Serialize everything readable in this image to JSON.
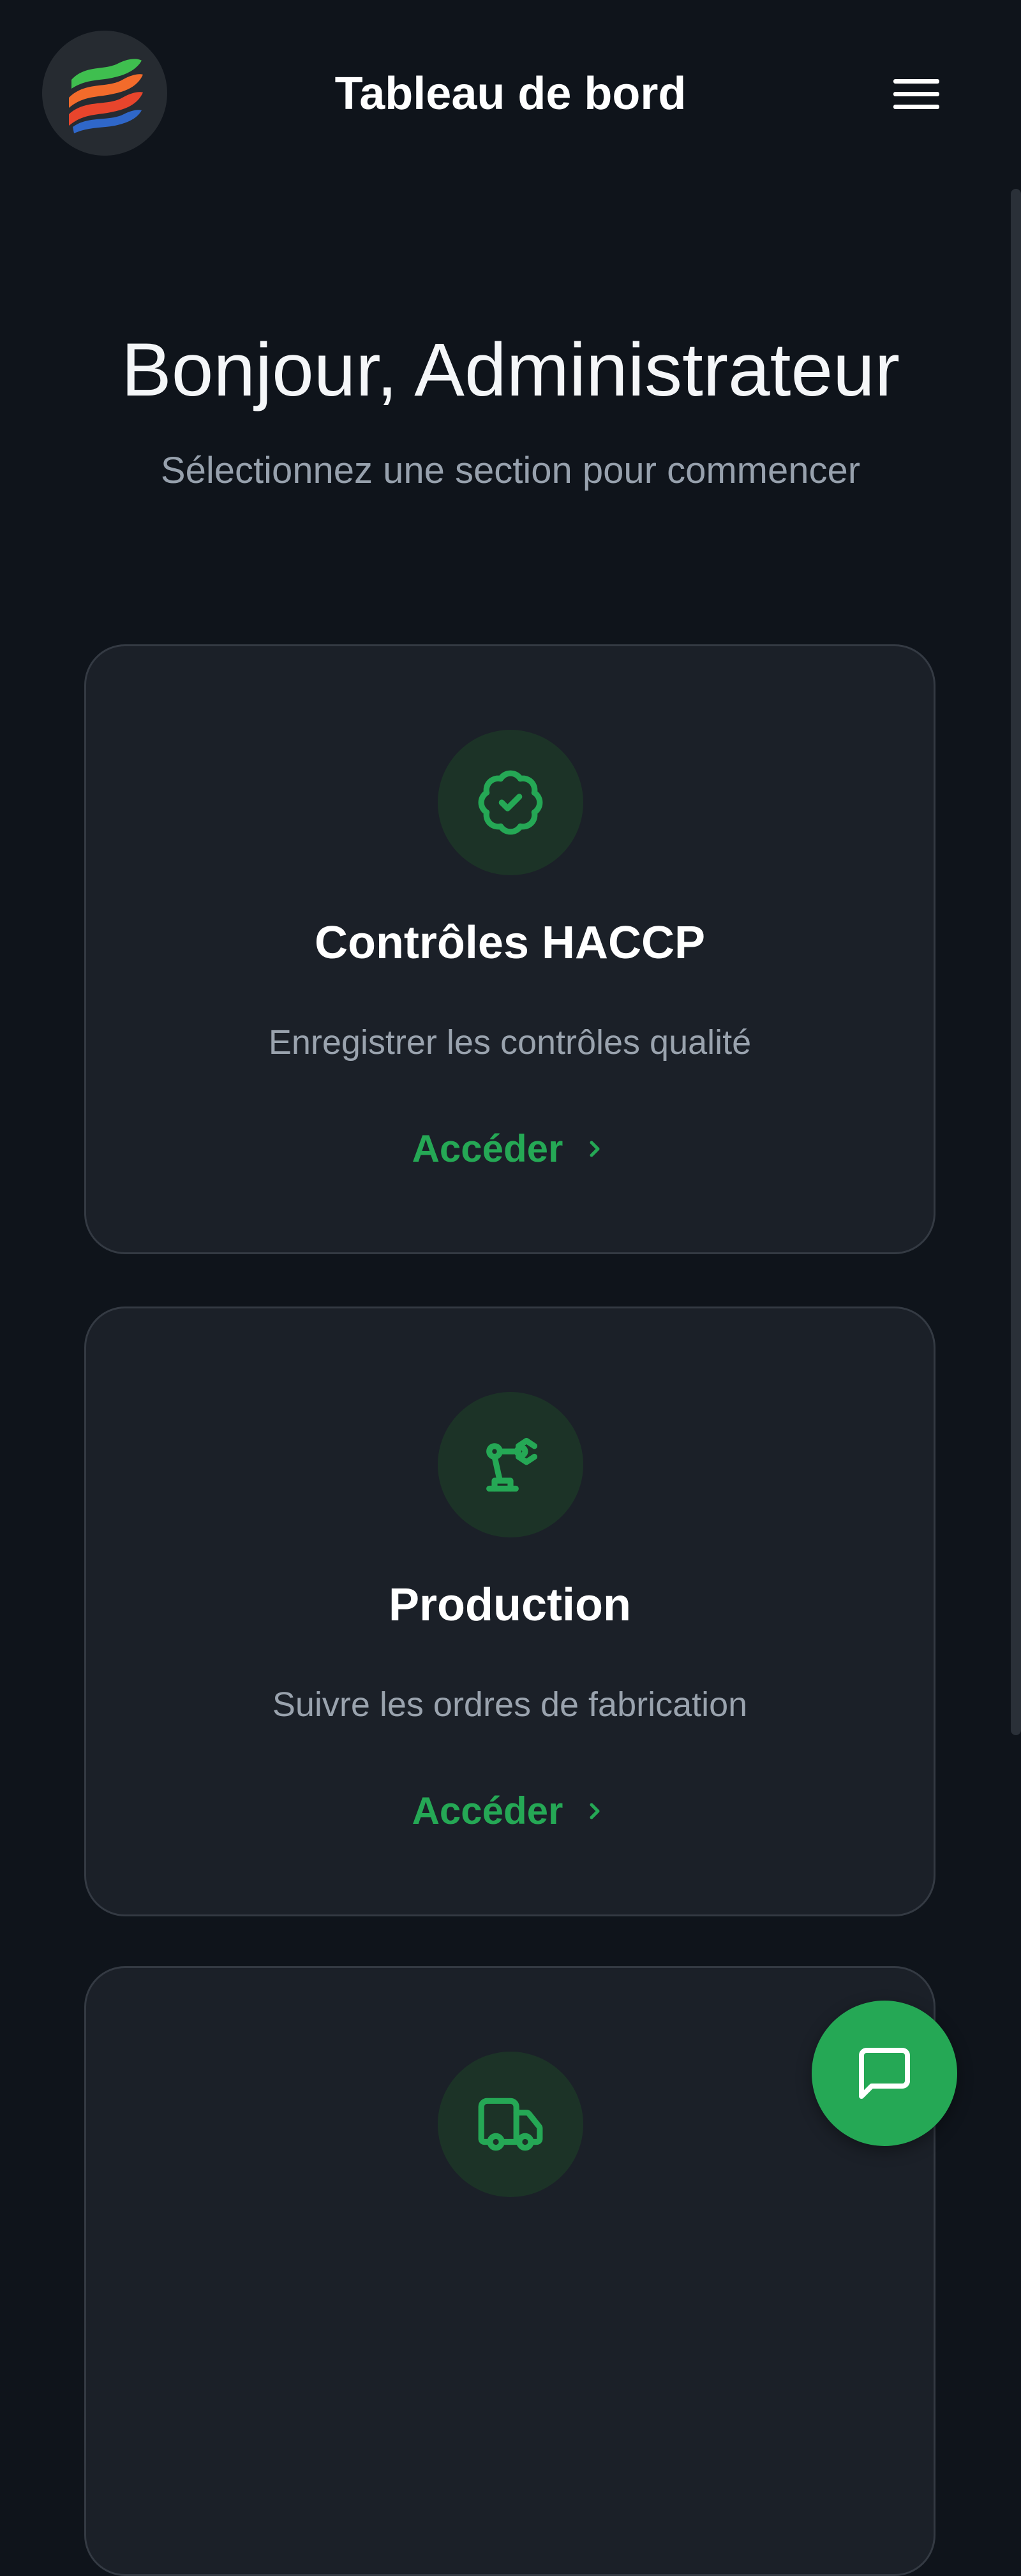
{
  "header": {
    "title": "Tableau de bord",
    "logo_icon": "flag-waves-logo",
    "menu_icon": "hamburger-menu-icon"
  },
  "main": {
    "greeting": "Bonjour, Administrateur",
    "subtitle": "Sélectionnez une section pour commencer",
    "cards": [
      {
        "icon": "badge-check-icon",
        "title": "Contrôles HACCP",
        "description": "Enregistrer les contrôles qualité",
        "link_label": "Accéder"
      },
      {
        "icon": "robot-arm-icon",
        "title": "Production",
        "description": "Suivre les ordres de fabrication",
        "link_label": "Accéder"
      },
      {
        "icon": "truck-icon",
        "title": "",
        "description": "",
        "link_label": ""
      }
    ]
  },
  "chat_button": {
    "icon": "chat-icon"
  },
  "colors": {
    "background": "#0f141b",
    "card_background": "#1b2028",
    "card_border": "#343a43",
    "accent_green": "#25a855",
    "icon_circle": "#1c3327",
    "muted_text": "#9aa3ae"
  }
}
